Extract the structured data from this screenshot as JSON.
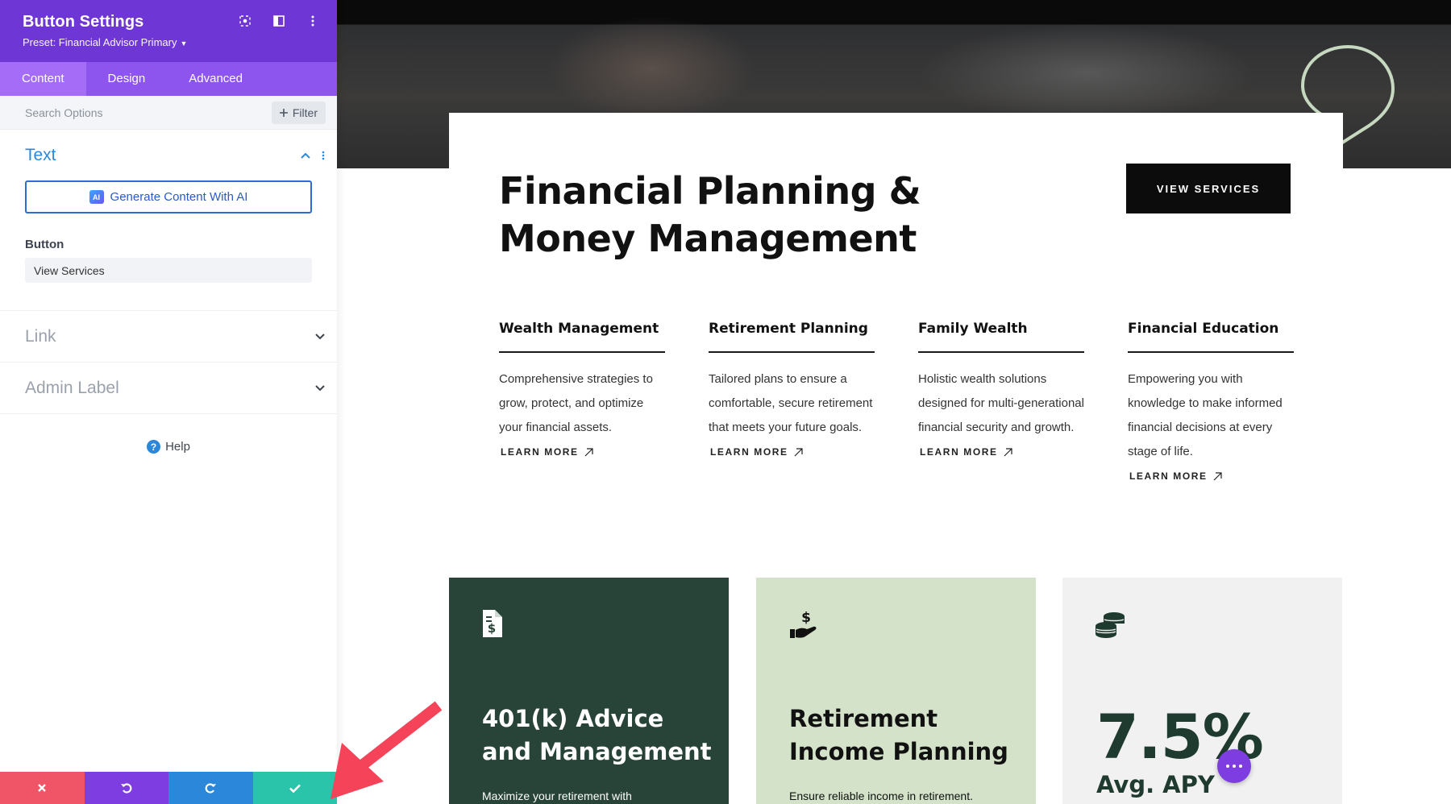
{
  "sidebar": {
    "title": "Button Settings",
    "preset": "Preset: Financial Advisor Primary",
    "tabs": [
      {
        "label": "Content",
        "active": true
      },
      {
        "label": "Design",
        "active": false
      },
      {
        "label": "Advanced",
        "active": false
      }
    ],
    "search_placeholder": "Search Options",
    "filter_label": "Filter",
    "sections": {
      "text": {
        "title": "Text",
        "ai_button": "Generate Content With AI",
        "ai_badge": "AI",
        "field_label": "Button",
        "field_value": "View Services"
      },
      "link": {
        "title": "Link"
      },
      "admin": {
        "title": "Admin Label"
      }
    },
    "help_label": "Help"
  },
  "page": {
    "title": "Financial Planning & Money Management",
    "cta": "VIEW SERVICES",
    "services": [
      {
        "title": "Wealth Management",
        "desc": "Comprehensive strategies to grow, protect, and optimize your financial assets.",
        "link": "LEARN MORE"
      },
      {
        "title": "Retirement Planning",
        "desc": "Tailored plans to ensure a comfortable, secure retirement that meets your future goals.",
        "link": "LEARN MORE"
      },
      {
        "title": "Family Wealth",
        "desc": "Holistic wealth solutions designed for multi-generational financial security and growth.",
        "link": "LEARN MORE"
      },
      {
        "title": "Financial Education",
        "desc": "Empowering you with knowledge to make informed financial decisions at every stage of life.",
        "link": "LEARN MORE"
      }
    ],
    "features": [
      {
        "title": "401(k) Advice and Management",
        "text": "Maximize your retirement with"
      },
      {
        "title": "Retirement Income Planning",
        "text": "Ensure reliable income in retirement."
      },
      {
        "stat": "7.5%",
        "stat_label": "Avg. APY"
      }
    ]
  },
  "colors": {
    "header_purple": "#6f36d6",
    "tab_purple": "#8e54ee",
    "accent_blue": "#2b87da",
    "close_red": "#ef5566",
    "save_teal": "#29c4a9",
    "dark_green": "#284337",
    "light_green": "#d3e2c8",
    "arrow_red": "#f5435a"
  },
  "icons": [
    "target-icon",
    "layout-icon",
    "more-vertical-icon",
    "plus-icon",
    "chevron-up-icon",
    "chevron-down-icon",
    "help-icon",
    "close-icon",
    "undo-icon",
    "redo-icon",
    "check-icon",
    "arrow-up-right-icon",
    "document-dollar-icon",
    "hand-dollar-icon",
    "coins-icon"
  ]
}
